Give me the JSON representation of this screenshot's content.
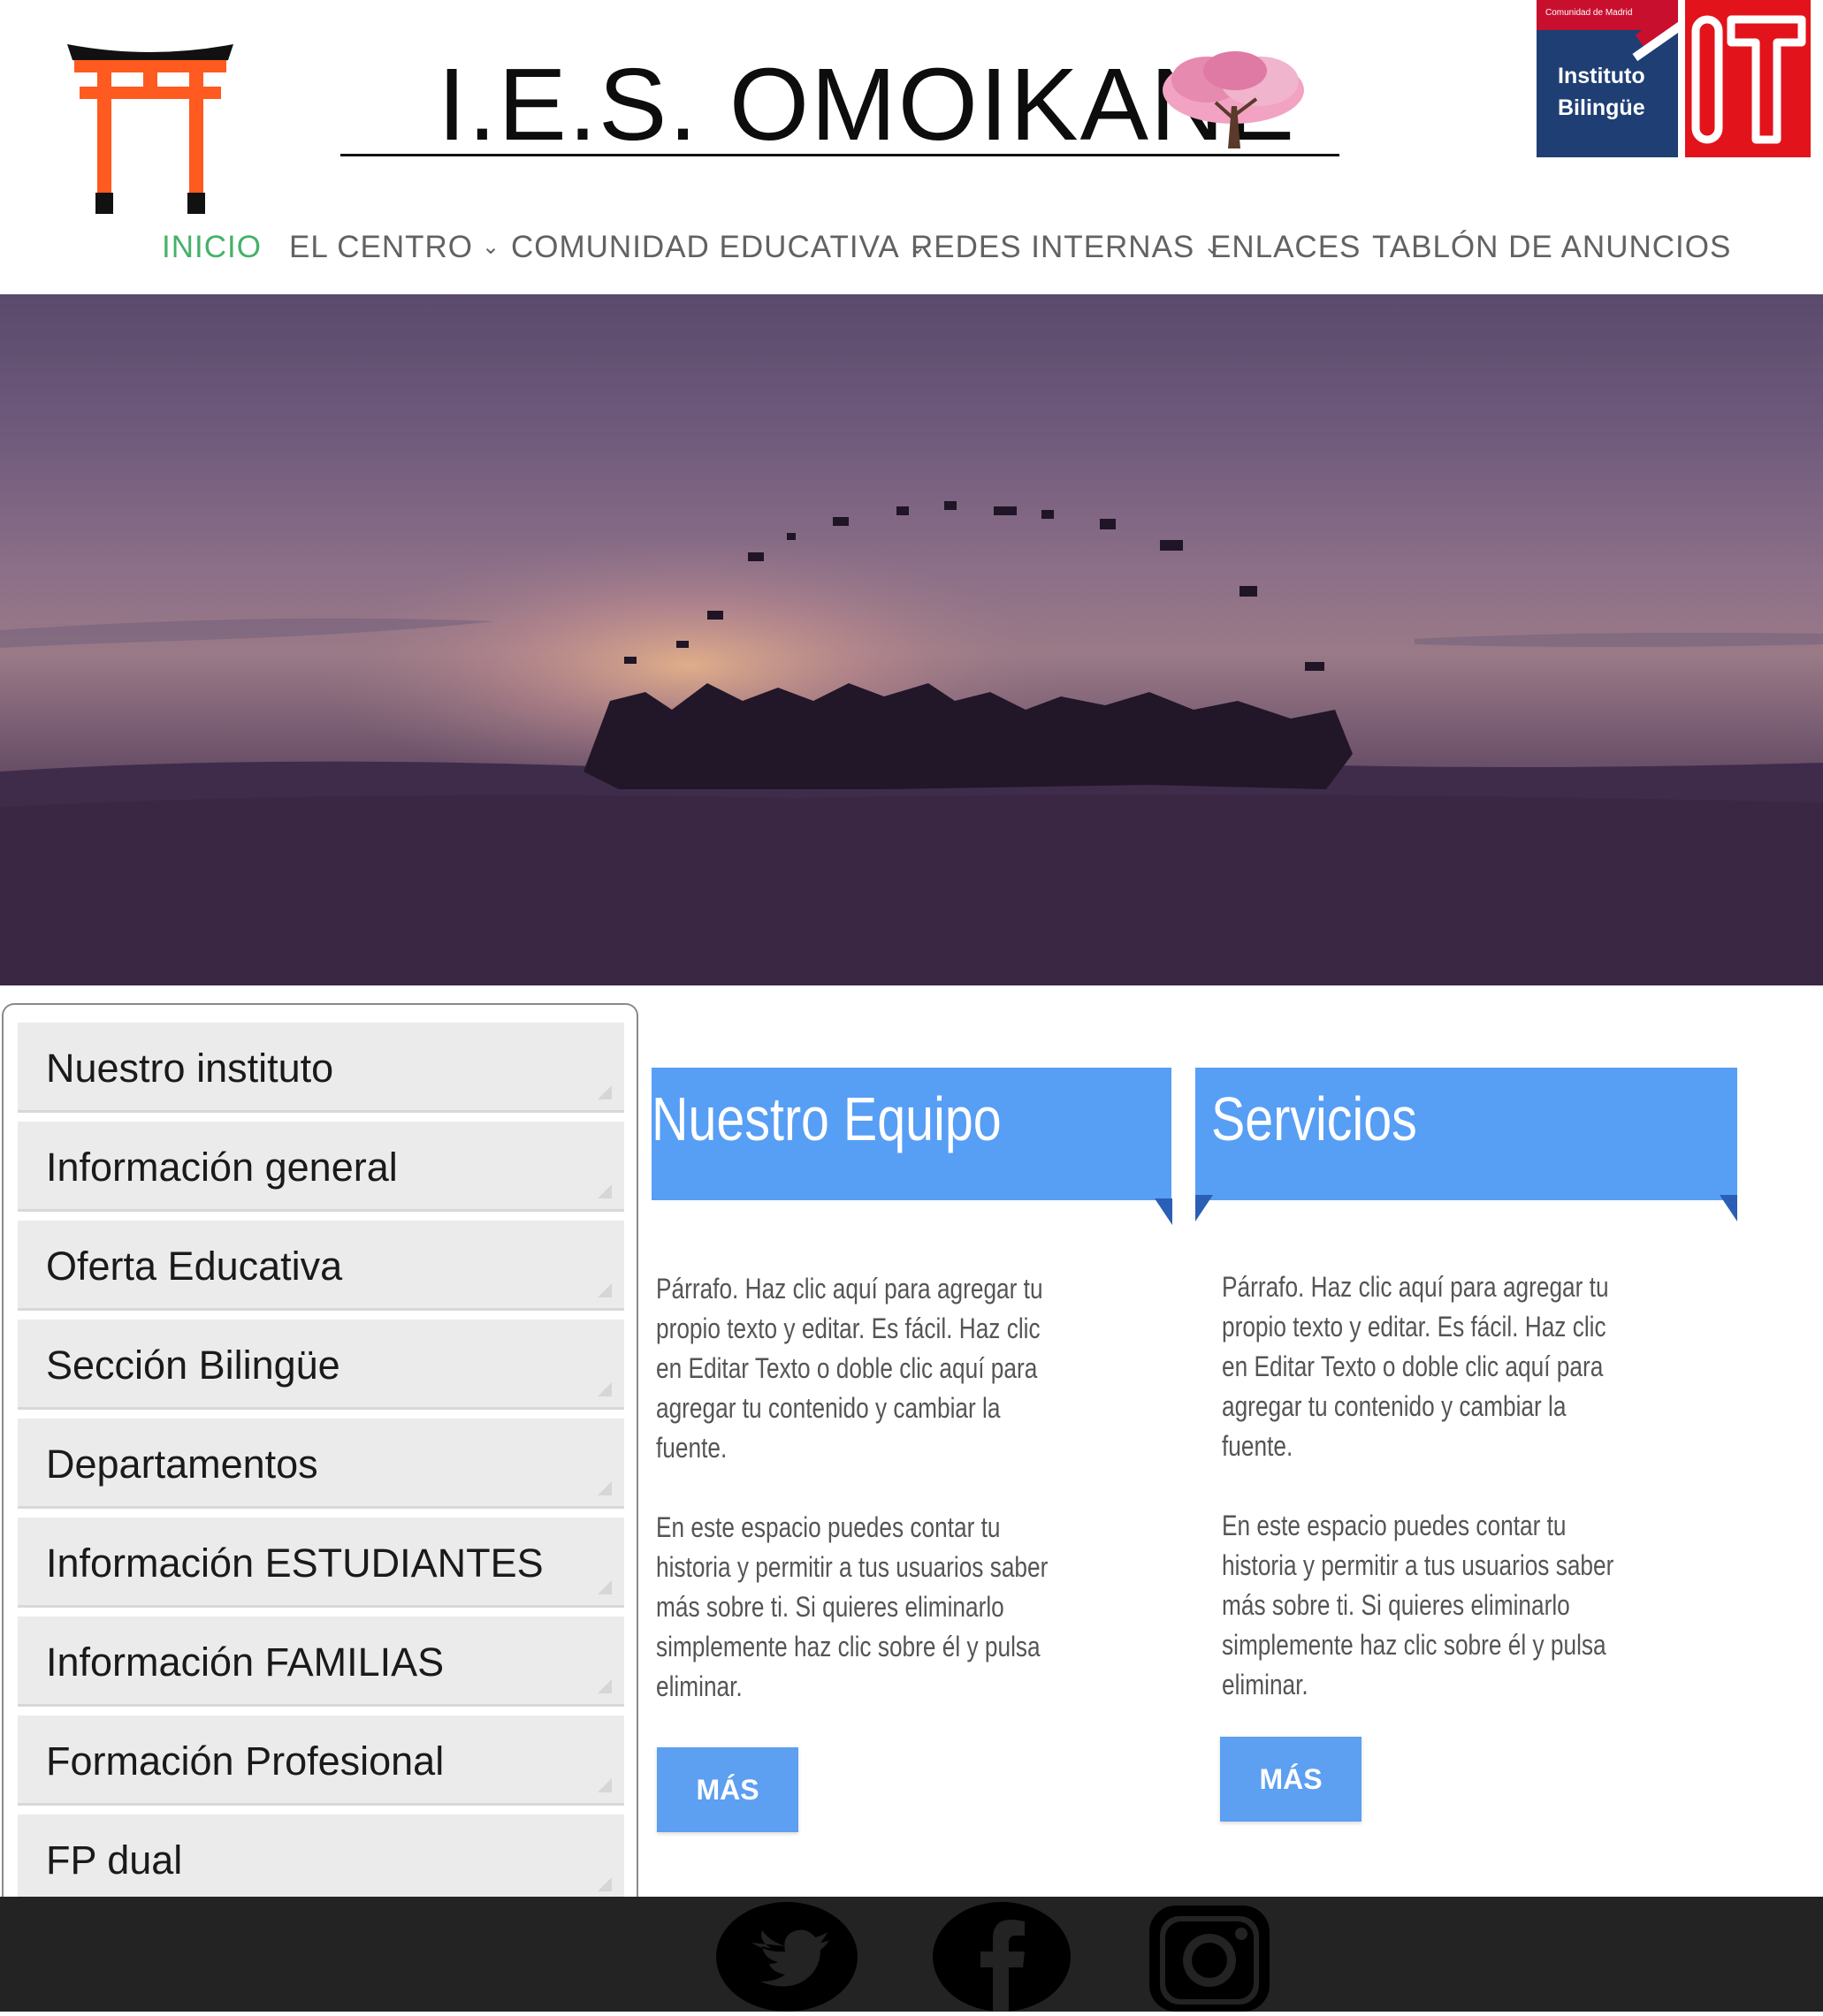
{
  "header": {
    "site_title": "I.E.S. OMOIKANE",
    "torii_logo": "torii-gate-logo",
    "tree_logo": "cherry-blossom-tree-logo",
    "badge": {
      "band_text": "Comunidad de Madrid",
      "line1": "Instituto",
      "line2": "Bilingüe",
      "it_logo": "IT"
    }
  },
  "nav": {
    "items": [
      {
        "label": "INICIO",
        "active": true
      },
      {
        "label": "EL CENTRO",
        "dropdown": true
      },
      {
        "label": "COMUNIDAD EDUCATIVA",
        "dropdown": true
      },
      {
        "label": "REDES INTERNAS",
        "dropdown": true
      },
      {
        "label": "ENLACES"
      },
      {
        "label": "TABLÓN DE ANUNCIOS"
      }
    ],
    "chevron": "⌄"
  },
  "hero": {
    "image": "graduates-throwing-caps-at-sunset"
  },
  "sidebar": {
    "items": [
      {
        "label": "Nuestro instituto"
      },
      {
        "label": "Información general"
      },
      {
        "label": "Oferta Educativa"
      },
      {
        "label": "Sección Bilingüe"
      },
      {
        "label": "Departamentos"
      },
      {
        "label": "Información ESTUDIANTES"
      },
      {
        "label": "Información FAMILIAS"
      },
      {
        "label": "Formación Profesional"
      },
      {
        "label": "FP dual"
      }
    ]
  },
  "cards": [
    {
      "title": "Nuestro Equipo",
      "paragraph1": "Párrafo. Haz clic aquí para agregar tu propio texto y editar. Es fácil. Haz clic en Editar Texto o doble clic aquí para agregar tu contenido y cambiar la fuente.",
      "paragraph2": "En este espacio puedes contar tu historia y permitir a tus usuarios saber más sobre ti. Si quieres eliminarlo simplemente haz clic sobre él y pulsa eliminar.",
      "button": "MÁS"
    },
    {
      "title": "Servicios",
      "paragraph1": "Párrafo. Haz clic aquí para agregar tu propio texto y editar. Es fácil. Haz clic en Editar Texto o doble clic aquí para agregar tu contenido y cambiar la fuente.",
      "paragraph2": "En este espacio puedes contar tu historia y permitir a tus usuarios saber más sobre ti. Si quieres eliminarlo simplemente haz clic sobre él y pulsa eliminar.",
      "button": "MÁS"
    }
  ],
  "footer": {
    "social": [
      "twitter-icon",
      "facebook-icon",
      "instagram-icon"
    ]
  },
  "colors": {
    "accent_blue": "#579ef5",
    "nav_active": "#46b16a",
    "nav_text": "#626262",
    "footer_bg": "#232323"
  }
}
